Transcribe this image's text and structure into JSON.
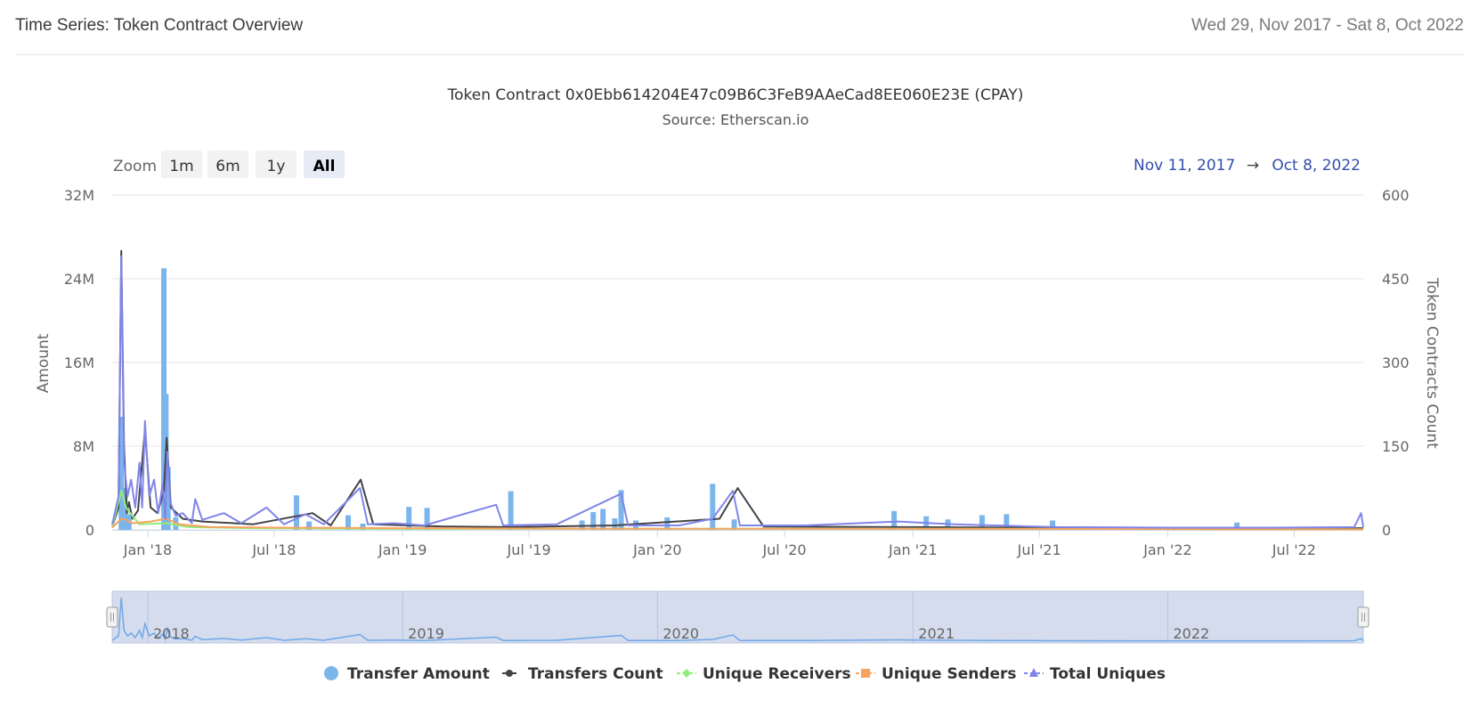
{
  "header": {
    "title": "Time Series: Token Contract Overview",
    "date_range": "Wed 29, Nov 2017 - Sat 8, Oct 2022"
  },
  "chart_data": {
    "type": "bar",
    "title": "Token Contract 0x0Ebb614204E47c09B6C3FeB9AAeCad8EE060E23E (CPAY)",
    "subtitle": "Source: Etherscan.io",
    "zoom": {
      "label": "Zoom",
      "buttons": [
        "1m",
        "6m",
        "1y",
        "All"
      ],
      "selected": "All"
    },
    "range_selector": {
      "from": "Nov 11, 2017",
      "arrow": "→",
      "to": "Oct 8, 2022"
    },
    "x_axis": {
      "start": "2017-11-11",
      "end": "2022-10-08",
      "ticks": [
        {
          "date": "2018-01-01",
          "label": "Jan '18"
        },
        {
          "date": "2018-07-01",
          "label": "Jul '18"
        },
        {
          "date": "2019-01-01",
          "label": "Jan '19"
        },
        {
          "date": "2019-07-01",
          "label": "Jul '19"
        },
        {
          "date": "2020-01-01",
          "label": "Jan '20"
        },
        {
          "date": "2020-07-01",
          "label": "Jul '20"
        },
        {
          "date": "2021-01-01",
          "label": "Jan '21"
        },
        {
          "date": "2021-07-01",
          "label": "Jul '21"
        },
        {
          "date": "2022-01-01",
          "label": "Jan '22"
        },
        {
          "date": "2022-07-01",
          "label": "Jul '22"
        }
      ]
    },
    "y_axis_left": {
      "label": "Amount",
      "ylim": [
        0,
        32000000
      ],
      "ticks": [
        {
          "v": 0,
          "label": "0"
        },
        {
          "v": 8000000,
          "label": "8M"
        },
        {
          "v": 16000000,
          "label": "16M"
        },
        {
          "v": 24000000,
          "label": "24M"
        },
        {
          "v": 32000000,
          "label": "32M"
        }
      ]
    },
    "y_axis_right": {
      "label": "Token Contracts Count",
      "ylim": [
        0,
        600
      ],
      "ticks": [
        {
          "v": 0,
          "label": "0"
        },
        {
          "v": 150,
          "label": "150"
        },
        {
          "v": 300,
          "label": "300"
        },
        {
          "v": 450,
          "label": "450"
        },
        {
          "v": 600,
          "label": "600"
        }
      ]
    },
    "grid": true,
    "legend_position": "bottom",
    "navigator": {
      "labels": [
        {
          "date": "2018-01-01",
          "label": "2018"
        },
        {
          "date": "2019-01-01",
          "label": "2019"
        },
        {
          "date": "2020-01-01",
          "label": "2020"
        },
        {
          "date": "2021-01-01",
          "label": "2021"
        },
        {
          "date": "2022-01-01",
          "label": "2022"
        }
      ]
    },
    "series": [
      {
        "name": "Transfer Amount",
        "kind": "bar",
        "axis": "left",
        "color": "#7cb5ec",
        "points": [
          [
            "2017-11-24",
            10800000
          ],
          [
            "2017-11-29",
            4000000
          ],
          [
            "2017-12-05",
            1500000
          ],
          [
            "2018-01-24",
            25000000
          ],
          [
            "2018-01-27",
            13000000
          ],
          [
            "2018-01-30",
            6000000
          ],
          [
            "2018-02-10",
            1200000
          ],
          [
            "2018-08-02",
            3300000
          ],
          [
            "2018-08-20",
            800000
          ],
          [
            "2018-10-15",
            1400000
          ],
          [
            "2018-11-05",
            600000
          ],
          [
            "2019-01-10",
            2200000
          ],
          [
            "2019-02-05",
            2100000
          ],
          [
            "2019-06-05",
            3700000
          ],
          [
            "2019-09-15",
            900000
          ],
          [
            "2019-10-01",
            1700000
          ],
          [
            "2019-10-15",
            2000000
          ],
          [
            "2019-11-01",
            1100000
          ],
          [
            "2019-11-10",
            3800000
          ],
          [
            "2019-12-01",
            900000
          ],
          [
            "2020-01-15",
            1200000
          ],
          [
            "2020-03-20",
            4400000
          ],
          [
            "2020-04-20",
            1000000
          ],
          [
            "2020-12-05",
            1800000
          ],
          [
            "2021-01-20",
            1300000
          ],
          [
            "2021-02-20",
            1000000
          ],
          [
            "2021-04-10",
            1400000
          ],
          [
            "2021-05-15",
            1500000
          ],
          [
            "2021-07-20",
            900000
          ],
          [
            "2022-04-10",
            700000
          ]
        ]
      },
      {
        "name": "Transfers Count",
        "kind": "line",
        "axis": "right",
        "color": "#434348",
        "points": [
          [
            "2017-11-11",
            5
          ],
          [
            "2017-11-20",
            40
          ],
          [
            "2017-11-24",
            500
          ],
          [
            "2017-11-28",
            150
          ],
          [
            "2017-12-02",
            30
          ],
          [
            "2017-12-05",
            50
          ],
          [
            "2017-12-10",
            20
          ],
          [
            "2017-12-18",
            35
          ],
          [
            "2017-12-28",
            180
          ],
          [
            "2018-01-05",
            40
          ],
          [
            "2018-01-15",
            30
          ],
          [
            "2018-01-24",
            70
          ],
          [
            "2018-01-28",
            165
          ],
          [
            "2018-02-03",
            40
          ],
          [
            "2018-02-20",
            20
          ],
          [
            "2018-03-20",
            15
          ],
          [
            "2018-06-01",
            10
          ],
          [
            "2018-08-25",
            30
          ],
          [
            "2018-09-20",
            8
          ],
          [
            "2018-11-02",
            90
          ],
          [
            "2018-11-20",
            10
          ],
          [
            "2019-03-01",
            6
          ],
          [
            "2019-06-01",
            5
          ],
          [
            "2019-11-01",
            8
          ],
          [
            "2020-03-30",
            20
          ],
          [
            "2020-04-25",
            75
          ],
          [
            "2020-06-01",
            6
          ],
          [
            "2021-01-01",
            5
          ],
          [
            "2021-06-01",
            4
          ],
          [
            "2022-01-01",
            3
          ],
          [
            "2022-10-08",
            3
          ]
        ]
      },
      {
        "name": "Unique Receivers",
        "kind": "line",
        "axis": "right",
        "color": "#90ed7d",
        "points": [
          [
            "2017-11-11",
            5
          ],
          [
            "2017-11-24",
            70
          ],
          [
            "2017-12-01",
            40
          ],
          [
            "2017-12-10",
            25
          ],
          [
            "2017-12-20",
            10
          ],
          [
            "2018-01-27",
            12
          ],
          [
            "2018-03-01",
            5
          ],
          [
            "2018-06-01",
            3
          ],
          [
            "2019-01-01",
            2
          ],
          [
            "2020-01-01",
            2
          ],
          [
            "2021-01-01",
            2
          ],
          [
            "2022-10-08",
            1
          ]
        ]
      },
      {
        "name": "Unique Senders",
        "kind": "line",
        "axis": "right",
        "color": "#f7a35c",
        "points": [
          [
            "2017-11-11",
            4
          ],
          [
            "2017-11-24",
            20
          ],
          [
            "2017-12-01",
            18
          ],
          [
            "2017-12-10",
            12
          ],
          [
            "2018-01-05",
            15
          ],
          [
            "2018-01-27",
            20
          ],
          [
            "2018-02-15",
            10
          ],
          [
            "2018-04-01",
            5
          ],
          [
            "2018-07-01",
            4
          ],
          [
            "2019-01-01",
            3
          ],
          [
            "2020-01-01",
            2
          ],
          [
            "2021-01-01",
            2
          ],
          [
            "2022-10-08",
            1
          ]
        ]
      },
      {
        "name": "Total Uniques",
        "kind": "line",
        "axis": "right",
        "color": "#8085e9",
        "points": [
          [
            "2017-11-11",
            10
          ],
          [
            "2017-11-20",
            60
          ],
          [
            "2017-11-24",
            490
          ],
          [
            "2017-11-28",
            120
          ],
          [
            "2017-12-03",
            60
          ],
          [
            "2017-12-08",
            90
          ],
          [
            "2017-12-14",
            40
          ],
          [
            "2017-12-20",
            120
          ],
          [
            "2017-12-24",
            40
          ],
          [
            "2017-12-28",
            195
          ],
          [
            "2018-01-03",
            60
          ],
          [
            "2018-01-10",
            90
          ],
          [
            "2018-01-16",
            30
          ],
          [
            "2018-01-22",
            80
          ],
          [
            "2018-01-26",
            20
          ],
          [
            "2018-01-29",
            140
          ],
          [
            "2018-02-02",
            50
          ],
          [
            "2018-02-10",
            25
          ],
          [
            "2018-02-20",
            30
          ],
          [
            "2018-03-05",
            12
          ],
          [
            "2018-03-10",
            55
          ],
          [
            "2018-03-20",
            18
          ],
          [
            "2018-04-20",
            30
          ],
          [
            "2018-05-15",
            12
          ],
          [
            "2018-06-20",
            40
          ],
          [
            "2018-07-15",
            10
          ],
          [
            "2018-08-15",
            28
          ],
          [
            "2018-09-10",
            10
          ],
          [
            "2018-11-01",
            75
          ],
          [
            "2018-11-12",
            10
          ],
          [
            "2018-12-20",
            12
          ],
          [
            "2019-02-01",
            8
          ],
          [
            "2019-05-15",
            45
          ],
          [
            "2019-05-25",
            8
          ],
          [
            "2019-08-10",
            10
          ],
          [
            "2019-11-10",
            65
          ],
          [
            "2019-11-20",
            8
          ],
          [
            "2020-02-01",
            8
          ],
          [
            "2020-03-20",
            20
          ],
          [
            "2020-04-18",
            70
          ],
          [
            "2020-04-28",
            8
          ],
          [
            "2020-08-01",
            8
          ],
          [
            "2020-12-10",
            15
          ],
          [
            "2021-03-01",
            10
          ],
          [
            "2021-07-25",
            5
          ],
          [
            "2022-01-01",
            4
          ],
          [
            "2022-06-01",
            4
          ],
          [
            "2022-09-25",
            5
          ],
          [
            "2022-10-05",
            30
          ],
          [
            "2022-10-08",
            5
          ]
        ]
      }
    ]
  }
}
